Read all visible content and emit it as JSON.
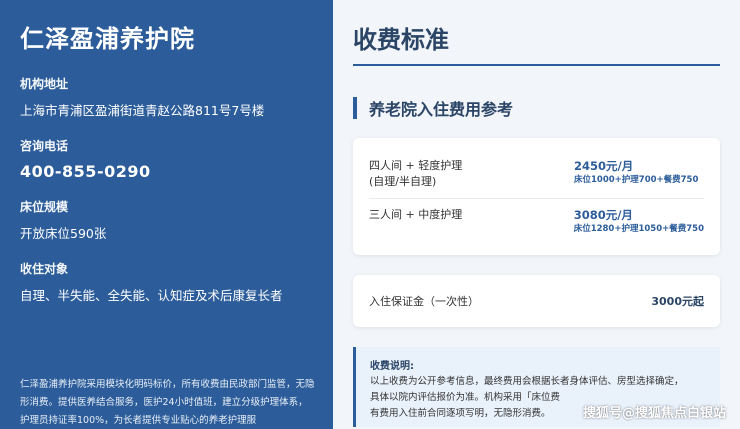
{
  "left": {
    "org_name": "仁泽盈浦养护院",
    "address_label": "机构地址",
    "address_value": "上海市青浦区盈浦街道青赵公路811号7号楼",
    "phone_label": "咨询电话",
    "phone_value": "400-855-0290",
    "beds_label": "床位规模",
    "beds_value": "开放床位590张",
    "target_label": "收住对象",
    "target_value": "自理、半失能、全失能、认知症及术后康复长者",
    "note": "仁泽盈浦养护院采用模块化明码标价，所有收费由民政部门监管，无隐形消费。提供医养结合服务，医护24小时值班，建立分级护理体系，护理员持证率100%，为长者提供专业贴心的养老护理服"
  },
  "right": {
    "page_title": "收费标准",
    "section_title": "养老院入住费用参考",
    "fees": [
      {
        "room": "四人间 + 轻度护理",
        "room_sub": "(自理/半自理)",
        "price": "2450元/月",
        "detail": "床位1000+护理700+餐费750"
      },
      {
        "room": "三人间 + 中度护理",
        "room_sub": "",
        "price": "3080元/月",
        "detail": "床位1280+护理1050+餐费750"
      }
    ],
    "deposit_label": "入住保证金（一次性）",
    "deposit_value": "3000元起",
    "note_title": "收费说明:",
    "note_lines": [
      "以上收费为公开参考信息，最终费用会根据长者身体评估、房型选择确定，",
      "具体以院内评估报价为准。机构采用「床位费",
      "有费用入住前合同逐项写明，无隐形消费。"
    ]
  },
  "watermark": "搜狐号@搜狐焦点白银站",
  "colors": {
    "brand": "#2c5d9a",
    "dark_text": "#2b4566",
    "bg": "#f2f5f9"
  }
}
